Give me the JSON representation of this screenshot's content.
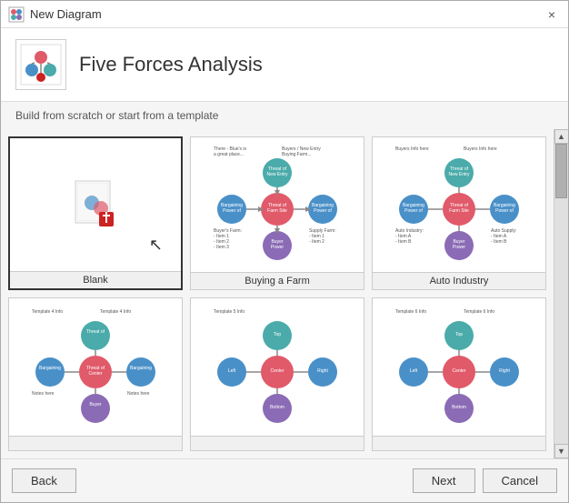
{
  "titleBar": {
    "title": "New Diagram",
    "closeLabel": "×"
  },
  "header": {
    "title": "Five Forces Analysis"
  },
  "subtitle": "Build from scratch or start from a template",
  "templates": [
    {
      "id": "blank",
      "label": "Blank",
      "selected": true,
      "type": "blank"
    },
    {
      "id": "buying-farm",
      "label": "Buying a Farm",
      "selected": false,
      "type": "five-forces"
    },
    {
      "id": "auto-industry",
      "label": "Auto Industry",
      "selected": false,
      "type": "five-forces"
    },
    {
      "id": "template4",
      "label": "",
      "selected": false,
      "type": "five-forces"
    },
    {
      "id": "template5",
      "label": "",
      "selected": false,
      "type": "five-forces"
    },
    {
      "id": "template6",
      "label": "",
      "selected": false,
      "type": "five-forces"
    }
  ],
  "buttons": {
    "back": "Back",
    "next": "Next",
    "cancel": "Cancel"
  },
  "colors": {
    "accent": "#333",
    "selected_border": "#222",
    "pink": "#e05a6a",
    "blue": "#4a90c8",
    "teal": "#4aabaa",
    "purple": "#8b6bb5",
    "green": "#7ab648",
    "arrow": "#888"
  }
}
